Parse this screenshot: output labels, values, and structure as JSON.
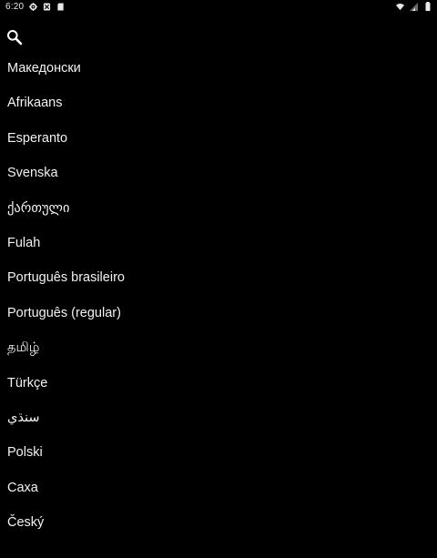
{
  "status_bar": {
    "time": "6:20",
    "left_icons": [
      "settings-icon",
      "nosim-icon",
      "sdcard-icon"
    ],
    "right_icons": [
      "wifi-icon",
      "signal-icon",
      "battery-icon"
    ]
  },
  "search": {
    "icon": "search-icon"
  },
  "languages": [
    "Македонски",
    "Afrikaans",
    "Esperanto",
    "Svenska",
    "ქართული",
    "Fulah",
    "Português brasileiro",
    "Português (regular)",
    "தமிழ்",
    "Türkçe",
    "سنڌي",
    "Polski",
    "Caxa",
    "Český"
  ],
  "colors": {
    "background": "#000000",
    "text": "#f2f2f2"
  }
}
